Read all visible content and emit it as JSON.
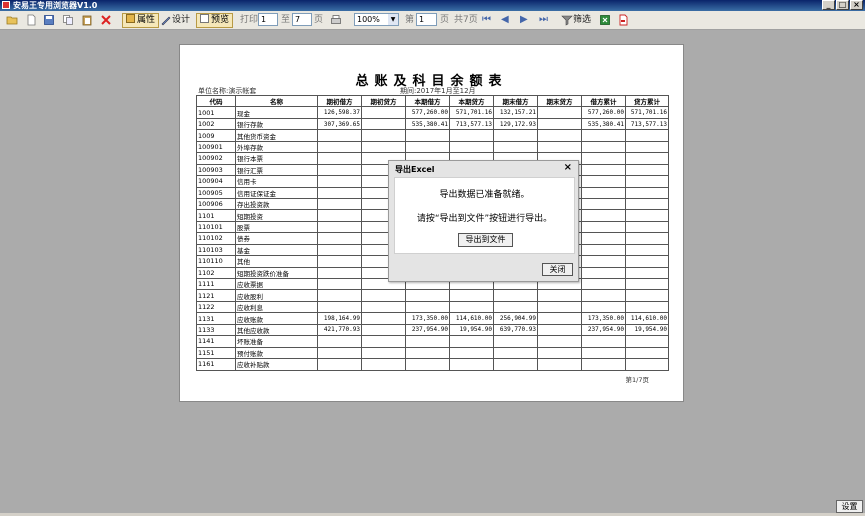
{
  "window": {
    "title": "安易王专用浏览器V1.0",
    "minimize": "_",
    "maximize": "□",
    "close": "×"
  },
  "toolbar": {
    "properties_label": "属性",
    "design_label": "设计",
    "preview_label": "预览",
    "print_label": "打印",
    "from_value": "1",
    "to_label": "至",
    "to_value": "7",
    "page_unit": "页",
    "zoom_value": "100%",
    "page_prefix": "第",
    "current_page": "1",
    "page_suffix": "页",
    "total_pages": "共7页",
    "filter_label": "筛选"
  },
  "report": {
    "title": "总账及科目余额表",
    "unit": "单位名称:演示帐套",
    "period": "期间:2017年1月至12月",
    "columns": [
      "代码",
      "名称",
      "期初借方",
      "期初贷方",
      "本期借方",
      "本期贷方",
      "期末借方",
      "期末贷方",
      "借方累计",
      "贷方累计"
    ],
    "rows": [
      [
        "1001",
        "现金",
        "126,598.37",
        "",
        "577,260.00",
        "571,701.16",
        "132,157.21",
        "",
        "577,260.00",
        "571,701.16"
      ],
      [
        "1002",
        "银行存款",
        "307,369.65",
        "",
        "535,380.41",
        "713,577.13",
        "129,172.93",
        "",
        "535,380.41",
        "713,577.13"
      ],
      [
        "1009",
        "其他货币资金",
        "",
        "",
        "",
        "",
        "",
        "",
        "",
        ""
      ],
      [
        "100901",
        "外埠存款",
        "",
        "",
        "",
        "",
        "",
        "",
        "",
        ""
      ],
      [
        "100902",
        "银行本票",
        "",
        "",
        "",
        "",
        "",
        "",
        "",
        ""
      ],
      [
        "100903",
        "银行汇票",
        "",
        "",
        "",
        "",
        "",
        "",
        "",
        ""
      ],
      [
        "100904",
        "信用卡",
        "",
        "",
        "",
        "",
        "",
        "",
        "",
        ""
      ],
      [
        "100905",
        "信用证保证金",
        "",
        "",
        "",
        "",
        "",
        "",
        "",
        ""
      ],
      [
        "100906",
        "存出投资款",
        "",
        "",
        "",
        "",
        "",
        "",
        "",
        ""
      ],
      [
        "1101",
        "短期投资",
        "",
        "",
        "",
        "",
        "",
        "",
        "",
        ""
      ],
      [
        "110101",
        "股票",
        "",
        "",
        "",
        "",
        "",
        "",
        "",
        ""
      ],
      [
        "110102",
        "债券",
        "",
        "",
        "",
        "",
        "",
        "",
        "",
        ""
      ],
      [
        "110103",
        "基金",
        "",
        "",
        "",
        "",
        "",
        "",
        "",
        ""
      ],
      [
        "110110",
        "其他",
        "",
        "",
        "",
        "",
        "",
        "",
        "",
        ""
      ],
      [
        "1102",
        "短期投资跌价准备",
        "",
        "",
        "",
        "",
        "",
        "",
        "",
        ""
      ],
      [
        "1111",
        "应收票据",
        "",
        "",
        "",
        "",
        "",
        "",
        "",
        ""
      ],
      [
        "1121",
        "应收股利",
        "",
        "",
        "",
        "",
        "",
        "",
        "",
        ""
      ],
      [
        "1122",
        "应收利息",
        "",
        "",
        "",
        "",
        "",
        "",
        "",
        ""
      ],
      [
        "1131",
        "应收账款",
        "198,164.99",
        "",
        "173,350.00",
        "114,610.00",
        "256,904.99",
        "",
        "173,350.00",
        "114,610.00"
      ],
      [
        "1133",
        "其他应收款",
        "421,770.93",
        "",
        "237,954.90",
        "19,954.90",
        "639,770.93",
        "",
        "237,954.90",
        "19,954.90"
      ],
      [
        "1141",
        "坏账准备",
        "",
        "",
        "",
        "",
        "",
        "",
        "",
        ""
      ],
      [
        "1151",
        "预付账款",
        "",
        "",
        "",
        "",
        "",
        "",
        "",
        ""
      ],
      [
        "1161",
        "应收补贴款",
        "",
        "",
        "",
        "",
        "",
        "",
        "",
        ""
      ]
    ],
    "pager": "第1/7页"
  },
  "dialog": {
    "title": "导出Excel",
    "close_symbol": "×",
    "message_1": "导出数据已准备就绪。",
    "message_2": "请按“导出到文件”按钮进行导出。",
    "export_button": "导出到文件",
    "close_button": "关闭"
  },
  "footer": {
    "settings_button": "设置"
  }
}
